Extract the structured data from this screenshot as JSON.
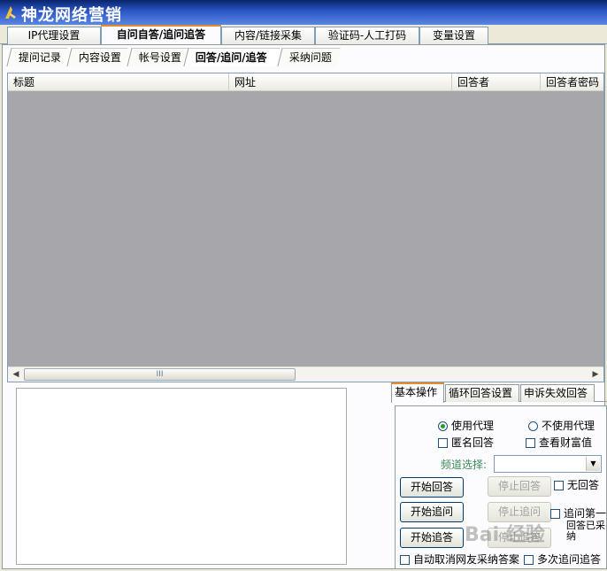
{
  "window": {
    "title": "神龙网络营销"
  },
  "main_tabs": [
    {
      "label": "IP代理设置"
    },
    {
      "label": "自问自答/追问追答"
    },
    {
      "label": "内容/链接采集"
    },
    {
      "label": "验证码-人工打码"
    },
    {
      "label": "变量设置"
    }
  ],
  "sub_tabs": [
    {
      "label": "提问记录"
    },
    {
      "label": "内容设置"
    },
    {
      "label": "帐号设置"
    },
    {
      "label": "回答/追问/追答"
    },
    {
      "label": "采纳问题"
    }
  ],
  "grid": {
    "columns": [
      "标题",
      "网址",
      "回答者",
      "回答者密码"
    ],
    "scroll_thumb_glyph": "III"
  },
  "op_tabs": [
    {
      "label": "基本操作"
    },
    {
      "label": "循环回答设置"
    },
    {
      "label": "申诉失效回答"
    }
  ],
  "options": {
    "use_proxy": "使用代理",
    "no_proxy": "不使用代理",
    "anonymous": "匿名回答",
    "view_wealth": "查看财富值",
    "channel_label": "频道选择:",
    "channel_value": "",
    "no_answer": "无回答",
    "follow_first": "追问第一",
    "adopted_partial": "回答已采纳",
    "auto_cancel": "自动取消网友采纳答案",
    "multi_follow": "多次追问追答"
  },
  "buttons": {
    "start_answer": "开始回答",
    "stop_answer": "停止回答",
    "start_follow_ask": "开始追问",
    "stop_follow_ask": "停止追问",
    "start_follow_answer": "开始追答",
    "stop_follow_answer": "停止追答"
  },
  "watermark": "Bai 经验"
}
